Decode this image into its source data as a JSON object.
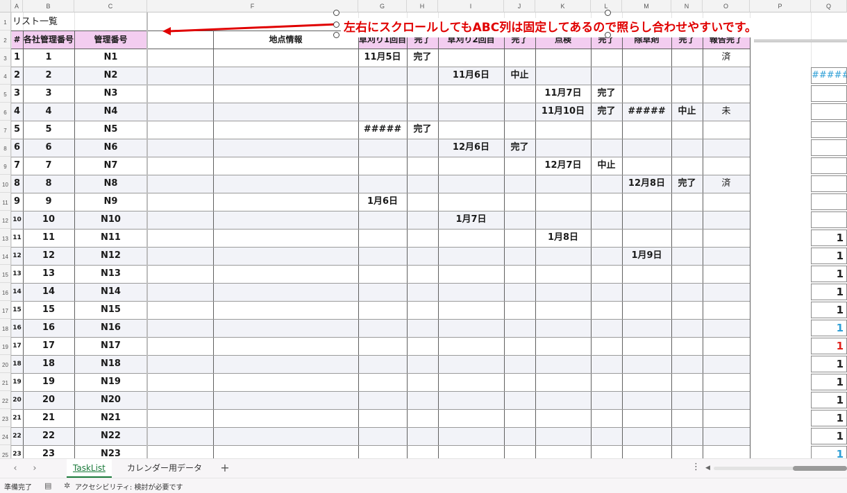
{
  "column_letters": [
    "A",
    "B",
    "C",
    "F",
    "G",
    "H",
    "I",
    "J",
    "K",
    "L",
    "M",
    "N",
    "O",
    "P",
    "Q"
  ],
  "title": "リスト一覧",
  "annotation": "左右にスクロールしてもABC列は固定してあるので照らし合わせやすいです。",
  "headers": {
    "a": "#",
    "b": "各社管理番号",
    "c": "管理番号",
    "f": "地点情報",
    "g": "草刈り1回目",
    "h": "完了",
    "i": "草刈り2回目",
    "j": "完了",
    "k": "点検",
    "l": "完了",
    "m": "除草剤",
    "n": "完了",
    "o": "報告完了"
  },
  "rows": [
    {
      "n": "1",
      "a": "1",
      "b": "1",
      "c": "N1",
      "g": "11月5日",
      "h": "完了",
      "i": "",
      "j": "",
      "k": "",
      "l": "",
      "m": "",
      "n2": "",
      "o": "済"
    },
    {
      "n": "2",
      "a": "2",
      "b": "2",
      "c": "N2",
      "g": "",
      "h": "",
      "i": "11月6日",
      "j": "中止",
      "k": "",
      "l": "",
      "m": "",
      "n2": "",
      "o": ""
    },
    {
      "n": "3",
      "a": "3",
      "b": "3",
      "c": "N3",
      "g": "",
      "h": "",
      "i": "",
      "j": "",
      "k": "11月7日",
      "l": "完了",
      "m": "",
      "n2": "",
      "o": ""
    },
    {
      "n": "4",
      "a": "4",
      "b": "4",
      "c": "N4",
      "g": "",
      "h": "",
      "i": "",
      "j": "",
      "k": "11月10日",
      "l": "完了",
      "m": "#####",
      "n2": "中止",
      "o": "未"
    },
    {
      "n": "5",
      "a": "5",
      "b": "5",
      "c": "N5",
      "g": "#####",
      "h": "完了",
      "i": "",
      "j": "",
      "k": "",
      "l": "",
      "m": "",
      "n2": "",
      "o": ""
    },
    {
      "n": "6",
      "a": "6",
      "b": "6",
      "c": "N6",
      "g": "",
      "h": "",
      "i": "12月6日",
      "j": "完了",
      "k": "",
      "l": "",
      "m": "",
      "n2": "",
      "o": ""
    },
    {
      "n": "7",
      "a": "7",
      "b": "7",
      "c": "N7",
      "g": "",
      "h": "",
      "i": "",
      "j": "",
      "k": "12月7日",
      "l": "中止",
      "m": "",
      "n2": "",
      "o": ""
    },
    {
      "n": "8",
      "a": "8",
      "b": "8",
      "c": "N8",
      "g": "",
      "h": "",
      "i": "",
      "j": "",
      "k": "",
      "l": "",
      "m": "12月8日",
      "n2": "完了",
      "o": "済"
    },
    {
      "n": "9",
      "a": "9",
      "b": "9",
      "c": "N9",
      "g": "1月6日",
      "h": "",
      "i": "",
      "j": "",
      "k": "",
      "l": "",
      "m": "",
      "n2": "",
      "o": ""
    },
    {
      "n": "10",
      "a": "10",
      "b": "10",
      "c": "N10",
      "g": "",
      "h": "",
      "i": "1月7日",
      "j": "",
      "k": "",
      "l": "",
      "m": "",
      "n2": "",
      "o": ""
    },
    {
      "n": "11",
      "a": "11",
      "b": "11",
      "c": "N11",
      "g": "",
      "h": "",
      "i": "",
      "j": "",
      "k": "1月8日",
      "l": "",
      "m": "",
      "n2": "",
      "o": ""
    },
    {
      "n": "12",
      "a": "12",
      "b": "12",
      "c": "N12",
      "g": "",
      "h": "",
      "i": "",
      "j": "",
      "k": "",
      "l": "",
      "m": "1月9日",
      "n2": "",
      "o": ""
    },
    {
      "n": "13",
      "a": "13",
      "b": "13",
      "c": "N13",
      "g": "",
      "h": "",
      "i": "",
      "j": "",
      "k": "",
      "l": "",
      "m": "",
      "n2": "",
      "o": ""
    },
    {
      "n": "14",
      "a": "14",
      "b": "14",
      "c": "N14",
      "g": "",
      "h": "",
      "i": "",
      "j": "",
      "k": "",
      "l": "",
      "m": "",
      "n2": "",
      "o": ""
    },
    {
      "n": "15",
      "a": "15",
      "b": "15",
      "c": "N15",
      "g": "",
      "h": "",
      "i": "",
      "j": "",
      "k": "",
      "l": "",
      "m": "",
      "n2": "",
      "o": ""
    },
    {
      "n": "16",
      "a": "16",
      "b": "16",
      "c": "N16",
      "g": "",
      "h": "",
      "i": "",
      "j": "",
      "k": "",
      "l": "",
      "m": "",
      "n2": "",
      "o": ""
    },
    {
      "n": "17",
      "a": "17",
      "b": "17",
      "c": "N17",
      "g": "",
      "h": "",
      "i": "",
      "j": "",
      "k": "",
      "l": "",
      "m": "",
      "n2": "",
      "o": ""
    },
    {
      "n": "18",
      "a": "18",
      "b": "18",
      "c": "N18",
      "g": "",
      "h": "",
      "i": "",
      "j": "",
      "k": "",
      "l": "",
      "m": "",
      "n2": "",
      "o": ""
    },
    {
      "n": "19",
      "a": "19",
      "b": "19",
      "c": "N19",
      "g": "",
      "h": "",
      "i": "",
      "j": "",
      "k": "",
      "l": "",
      "m": "",
      "n2": "",
      "o": ""
    },
    {
      "n": "20",
      "a": "20",
      "b": "20",
      "c": "N20",
      "g": "",
      "h": "",
      "i": "",
      "j": "",
      "k": "",
      "l": "",
      "m": "",
      "n2": "",
      "o": ""
    },
    {
      "n": "21",
      "a": "21",
      "b": "21",
      "c": "N21",
      "g": "",
      "h": "",
      "i": "",
      "j": "",
      "k": "",
      "l": "",
      "m": "",
      "n2": "",
      "o": ""
    },
    {
      "n": "22",
      "a": "22",
      "b": "22",
      "c": "N22",
      "g": "",
      "h": "",
      "i": "",
      "j": "",
      "k": "",
      "l": "",
      "m": "",
      "n2": "",
      "o": ""
    },
    {
      "n": "23",
      "a": "23",
      "b": "23",
      "c": "N23",
      "g": "",
      "h": "",
      "i": "",
      "j": "",
      "k": "",
      "l": "",
      "m": "",
      "n2": "",
      "o": ""
    }
  ],
  "q_column": [
    {
      "text": "",
      "style": ""
    },
    {
      "text": "#####",
      "style": "blue thin"
    },
    {
      "text": "",
      "style": ""
    },
    {
      "text": "",
      "style": ""
    },
    {
      "text": "",
      "style": ""
    },
    {
      "text": "",
      "style": ""
    },
    {
      "text": "",
      "style": ""
    },
    {
      "text": "",
      "style": ""
    },
    {
      "text": "",
      "style": ""
    },
    {
      "text": "",
      "style": ""
    },
    {
      "text": "1",
      "style": ""
    },
    {
      "text": "1",
      "style": ""
    },
    {
      "text": "1",
      "style": ""
    },
    {
      "text": "1",
      "style": ""
    },
    {
      "text": "1",
      "style": ""
    },
    {
      "text": "1",
      "style": "blue"
    },
    {
      "text": "1",
      "style": "red"
    },
    {
      "text": "1",
      "style": ""
    },
    {
      "text": "1",
      "style": ""
    },
    {
      "text": "1",
      "style": ""
    },
    {
      "text": "1",
      "style": ""
    },
    {
      "text": "1",
      "style": ""
    },
    {
      "text": "1",
      "style": "blue"
    }
  ],
  "sheet_tabs": [
    {
      "label": "TaskList",
      "active": true
    },
    {
      "label": "カレンダー用データ",
      "active": false
    }
  ],
  "add_sheet_label": "+",
  "status": {
    "ready": "準備完了",
    "accessibility": "アクセシビリティ: 検討が必要です"
  },
  "colors": {
    "header_fill": "#f3cdf0",
    "annotation": "#e00000",
    "band_fill": "#f2f3f8",
    "active_tab": "#1a7a3a"
  },
  "icons": {
    "tab_prev": "chevron-left-icon",
    "tab_next": "chevron-right-icon",
    "more": "vertical-dots-icon",
    "page_view": "page-view-icon",
    "accessibility": "accessibility-icon"
  }
}
